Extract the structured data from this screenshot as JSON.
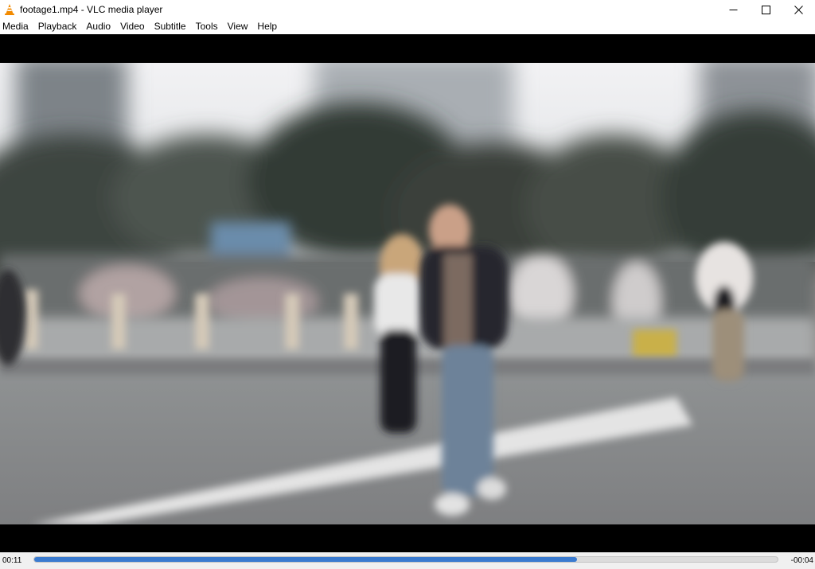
{
  "window": {
    "title": "footage1.mp4 - VLC media player",
    "icon": "vlc-cone-icon",
    "controls": [
      "minimize-icon",
      "maximize-icon",
      "close-icon"
    ]
  },
  "menu": {
    "items": [
      "Media",
      "Playback",
      "Audio",
      "Video",
      "Subtitle",
      "Tools",
      "View",
      "Help"
    ]
  },
  "video": {
    "filename": "footage1.mp4"
  },
  "playback": {
    "elapsed": "00:11",
    "remaining": "-00:04",
    "progress": 0.73,
    "accent": "#3a7bd0"
  }
}
